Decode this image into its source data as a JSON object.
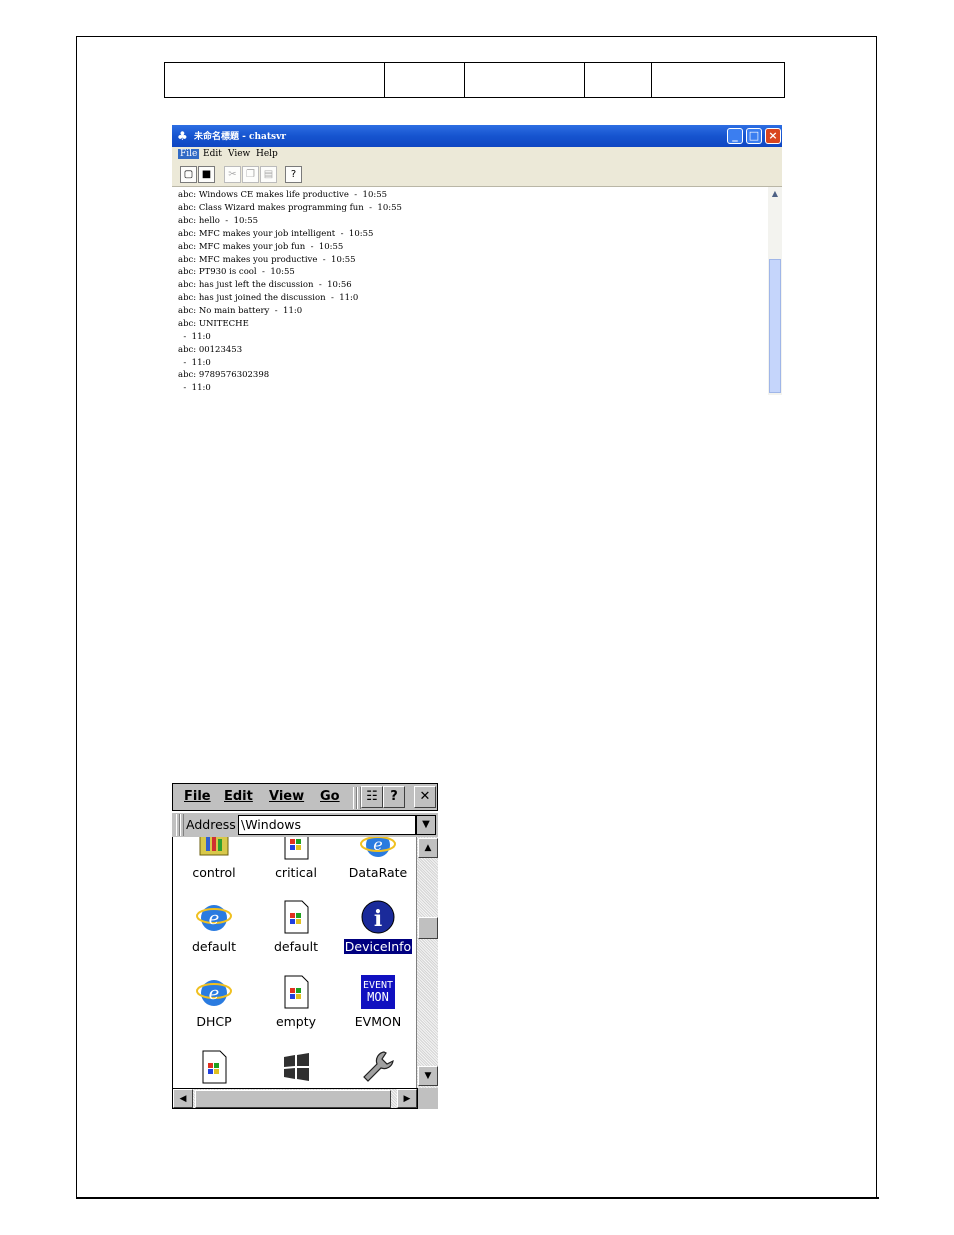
{
  "chat_window": {
    "title": "未命名標題 - chatsvr",
    "menu": [
      "File",
      "Edit",
      "View",
      "Help"
    ],
    "toolbar_icons": [
      "new-icon",
      "save-icon",
      "cut-icon",
      "copy-icon",
      "paste-icon",
      "help-icon"
    ],
    "lines": [
      "abc: Windows CE makes life productive  -  10:55",
      "abc: Class Wizard makes programming fun  -  10:55",
      "abc: hello  -  10:55",
      "abc: MFC makes your job intelligent  -  10:55",
      "abc: MFC makes your job fun  -  10:55",
      "abc: MFC makes you productive  -  10:55",
      "abc: PT930 is cool  -  10:55",
      "abc: has just left the discussion  -  10:56",
      "abc: has just joined the discussion  -  11:0",
      "abc: No main battery  -  11:0",
      "abc: UNITECHE",
      "  -  11:0",
      "abc: 00123453",
      "  -  11:0",
      "abc: 9789576302398",
      "  -  11:0"
    ]
  },
  "explorer": {
    "menu": [
      "File",
      "Edit",
      "View",
      "Go"
    ],
    "help_label": "?",
    "close_label": "✕",
    "address_label": "Address",
    "address_value": "\\Windows",
    "files": [
      {
        "label": "control",
        "icon": "control-panel-icon"
      },
      {
        "label": "critical",
        "icon": "windows-file-icon"
      },
      {
        "label": "DataRate",
        "icon": "internet-explorer-icon"
      },
      {
        "label": "default",
        "icon": "internet-explorer-icon"
      },
      {
        "label": "default",
        "icon": "windows-file-icon"
      },
      {
        "label": "DeviceInfo",
        "icon": "info-icon",
        "selected": true
      },
      {
        "label": "DHCP",
        "icon": "internet-explorer-icon"
      },
      {
        "label": "empty",
        "icon": "windows-file-icon"
      },
      {
        "label": "EVMON",
        "icon": "event-monitor-icon",
        "icon_text": "EVENT MON"
      },
      {
        "label": "",
        "icon": "windows-file-icon"
      },
      {
        "label": "",
        "icon": "windows-logo-icon"
      },
      {
        "label": "",
        "icon": "wrench-icon"
      }
    ]
  }
}
